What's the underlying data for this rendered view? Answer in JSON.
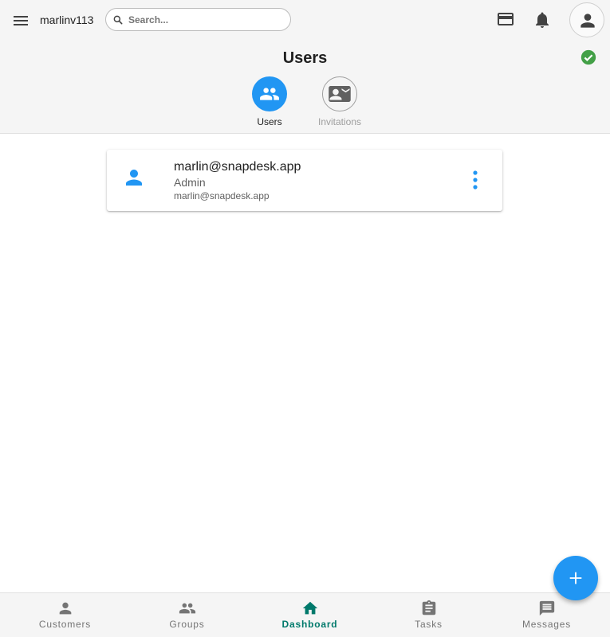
{
  "topbar": {
    "username": "marlinv113",
    "search_placeholder": "Search...",
    "icons": {
      "menu": "menu-icon",
      "search": "search-icon",
      "card": "credit-card-icon",
      "notifications": "bell-icon",
      "account": "account-icon"
    }
  },
  "header": {
    "title": "Users",
    "status_icon": "check-circle-icon",
    "status_color": "#43a047",
    "tabs": [
      {
        "label": "Users",
        "icon": "people-icon",
        "active": true
      },
      {
        "label": "Invitations",
        "icon": "contact-mail-icon",
        "active": false
      }
    ]
  },
  "users": [
    {
      "email": "marlin@snapdesk.app",
      "role": "Admin",
      "secondary": "marlin@snapdesk.app",
      "avatar_icon": "person-icon"
    }
  ],
  "fab": {
    "icon": "plus-icon"
  },
  "bottom_nav": {
    "items": [
      {
        "label": "Customers",
        "icon": "person-icon",
        "active": false
      },
      {
        "label": "Groups",
        "icon": "group-icon",
        "active": false
      },
      {
        "label": "Dashboard",
        "icon": "home-icon",
        "active": true
      },
      {
        "label": "Tasks",
        "icon": "clipboard-icon",
        "active": false
      },
      {
        "label": "Messages",
        "icon": "message-icon",
        "active": false
      }
    ]
  },
  "colors": {
    "accent": "#2196f3",
    "active_nav": "#00796b",
    "user_icon": "#2196f3",
    "toolbar_icon": "#424242"
  }
}
